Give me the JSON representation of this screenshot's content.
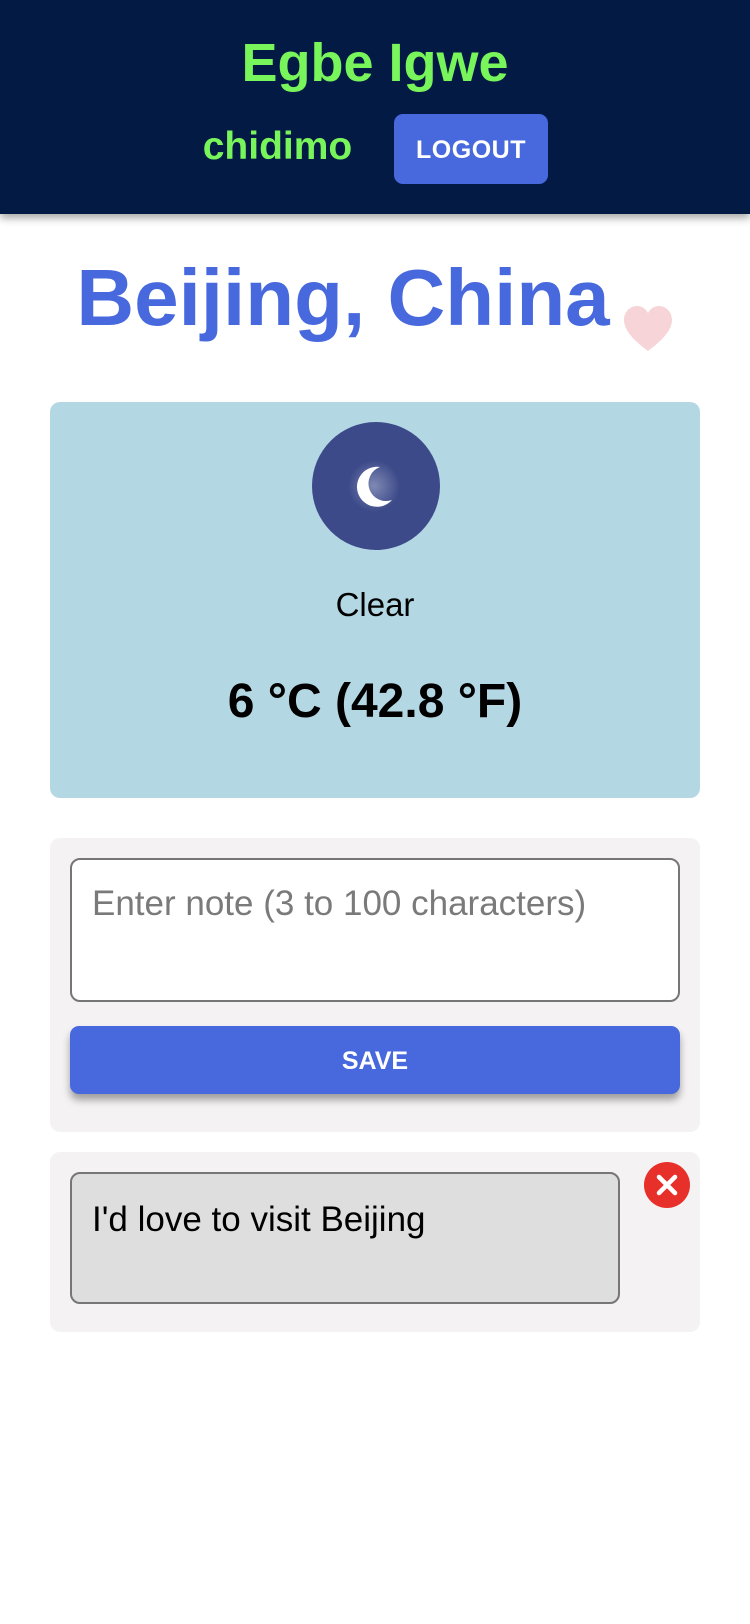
{
  "header": {
    "app_title": "Egbe Igwe",
    "username": "chidimo",
    "logout_label": "LOGOUT",
    "background_color": "#021a44",
    "accent_color": "#78f55a"
  },
  "city": {
    "name": "Beijing, China",
    "favorite_icon": "heart-icon",
    "favorite_icon_color": "#f7d4d8"
  },
  "weather": {
    "icon": "moon-icon",
    "description": "Clear",
    "temperature": "6 °C (42.8 °F)",
    "card_color": "#b4d7e4"
  },
  "note_form": {
    "placeholder": "Enter note (3 to 100 characters)",
    "value": "",
    "save_label": "SAVE",
    "button_color": "#4769dd"
  },
  "notes": [
    {
      "text": "I'd love to visit Beijing",
      "delete_icon": "close-icon",
      "delete_color": "#e8302a"
    }
  ]
}
